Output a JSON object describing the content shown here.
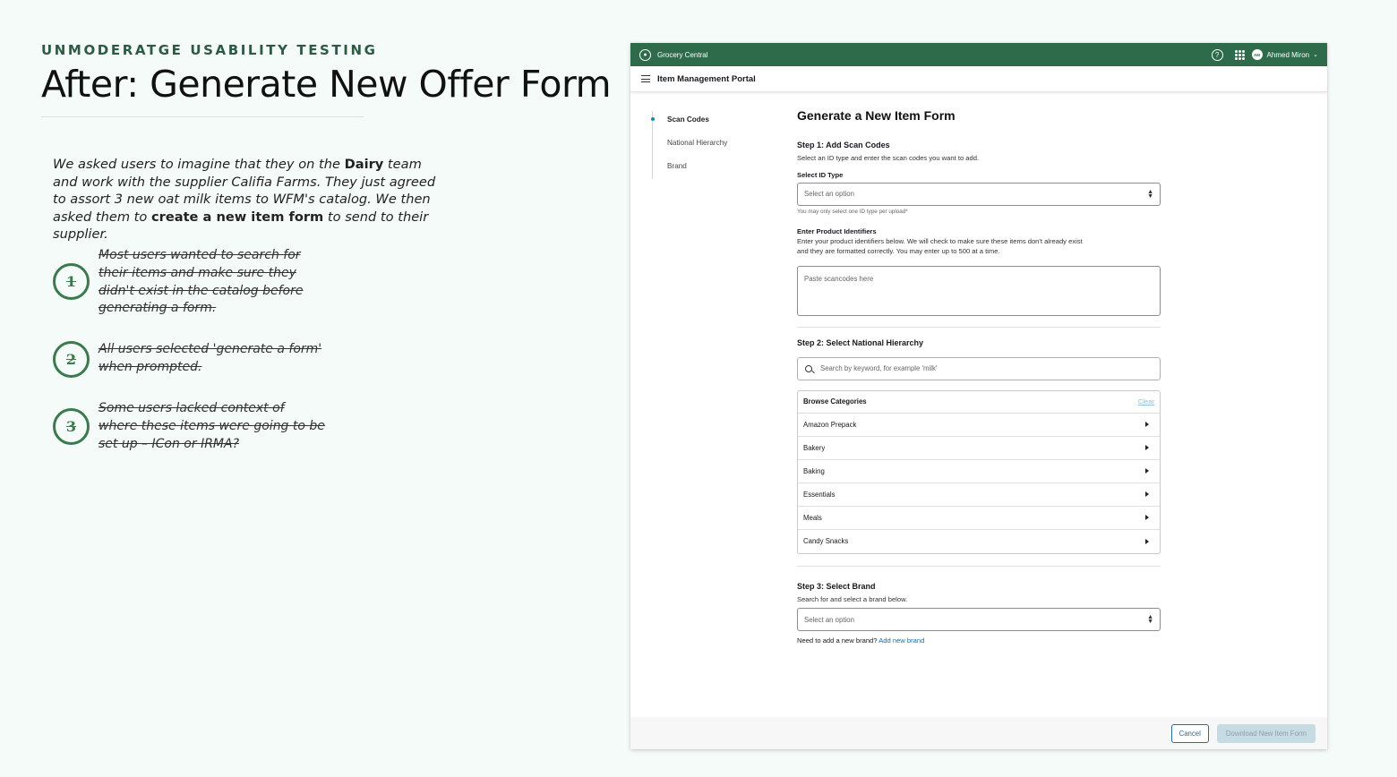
{
  "slide": {
    "eyebrow": "UNMODERATGE USABILITY TESTING",
    "title": "After: Generate New Offer Form",
    "intro": {
      "p1": "We asked users to imagine that they on the ",
      "b1": "Dairy",
      "p2": " team and work with the supplier Califia Farms. They just agreed to assort 3 new oat milk items to WFM's catalog. We then asked them to ",
      "b2": "create a new item form",
      "p3": " to send to their supplier."
    },
    "findings": [
      {
        "num": "1",
        "text": "Most users wanted to search for their items and make sure they didn't exist in the catalog before generating a form."
      },
      {
        "num": "2",
        "text": "All users selected 'generate a form' when prompted."
      },
      {
        "num": "3",
        "text": "Some users lacked context of where these items were going to be set up – ICon or IRMA?"
      }
    ]
  },
  "app": {
    "brand": "Grocery Central",
    "help_glyph": "?",
    "user_initials": "AM",
    "user_name": "Ahmed Miron",
    "portal_title": "Item Management Portal",
    "stepnav": [
      "Scan Codes",
      "National Hierarchy",
      "Brand"
    ],
    "form": {
      "title": "Generate a New Item Form",
      "step1": {
        "heading": "Step 1: Add Scan Codes",
        "desc": "Select an ID type and enter the scan codes you want to add.",
        "id_label": "Select ID Type",
        "id_placeholder": "Select an option",
        "id_hint": "You may only select one ID type per upload*",
        "ids_label": "Enter Product Identifiers",
        "ids_desc": "Enter your product identifiers below. We will check to make sure these items don't already exist and they are formatted correctly. You may enter up to 500 at a time.",
        "ids_placeholder": "Paste scancodes here"
      },
      "step2": {
        "heading": "Step 2: Select National Hierarchy",
        "search_placeholder": "Search by keyword, for example 'milk'",
        "browse_label": "Browse Categories",
        "clear_label": "Clear",
        "categories": [
          "Amazon Prepack",
          "Bakery",
          "Baking",
          "Essentials",
          "Meals",
          "Candy Snacks"
        ]
      },
      "step3": {
        "heading": "Step 3: Select Brand",
        "desc": "Search for and select a brand below.",
        "brand_placeholder": "Select an option",
        "need_brand": "Need to add a new brand?",
        "add_brand": "Add new brand"
      }
    },
    "footer": {
      "cancel": "Cancel",
      "download": "Download New Item Form"
    }
  }
}
